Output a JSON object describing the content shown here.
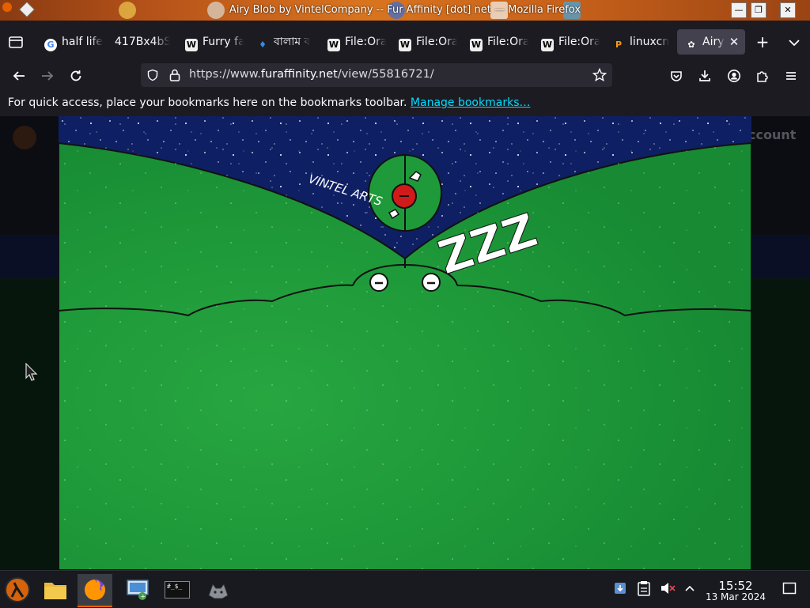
{
  "window": {
    "title": "Airy Blob by VintelCompany -- Fur Affinity [dot] net — Mozilla Firefox"
  },
  "tabs": [
    {
      "label": "half life",
      "icon": "google-icon",
      "active": false
    },
    {
      "label": "417Bx4bS",
      "icon": "none",
      "active": false
    },
    {
      "label": "Furry fa",
      "icon": "wikipedia-icon",
      "active": false
    },
    {
      "label": "বালাম ব",
      "icon": "flame-icon",
      "active": false
    },
    {
      "label": "File:Ora",
      "icon": "wikipedia-icon",
      "active": false
    },
    {
      "label": "File:Ora",
      "icon": "wikipedia-icon",
      "active": false
    },
    {
      "label": "File:Ora",
      "icon": "wikipedia-icon",
      "active": false
    },
    {
      "label": "File:Ora",
      "icon": "wikipedia-icon",
      "active": false
    },
    {
      "label": "linuxcn",
      "icon": "pin-icon",
      "active": false
    },
    {
      "label": "Airy",
      "icon": "paw-icon",
      "active": true
    }
  ],
  "navbar": {
    "url_prefix": "https://www.",
    "url_domain": "furaffinity.net",
    "url_path": "/view/55816721/"
  },
  "bookmarks": {
    "message": "For quick access, place your bookmarks here on the bookmarks toolbar.",
    "link": "Manage bookmarks…"
  },
  "page": {
    "account_label": "ccount",
    "artwork": {
      "signature": "VINTEL ARTS",
      "sleep_text": "ZZZ"
    }
  },
  "taskbar": {
    "apps": [
      "half-life-launcher-icon",
      "file-manager-icon",
      "firefox-icon",
      "remote-desktop-icon",
      "terminal-icon",
      "wolf-app-icon"
    ],
    "terminal_label": "#_$_",
    "time": "15:52",
    "date": "13 Mar 2024"
  },
  "colors": {
    "tab_active": "#42414d",
    "link": "#00ddff",
    "blob_green": "#1f9a3a",
    "sky": "#0f1f63",
    "firefox_orange": "#e66000"
  }
}
